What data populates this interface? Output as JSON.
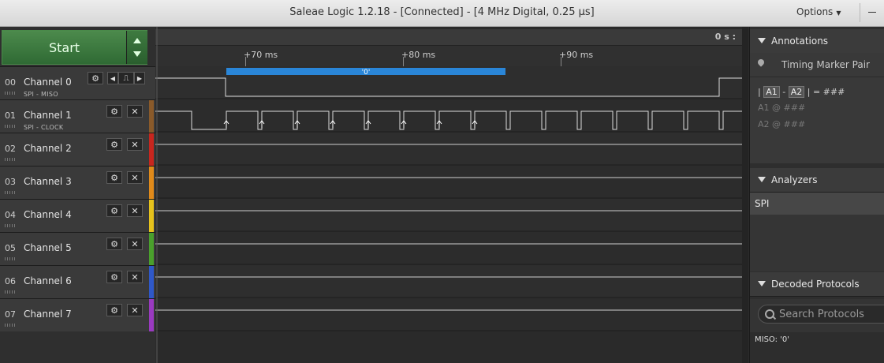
{
  "window": {
    "title": "Saleae Logic 1.2.18 - [Connected] - [4 MHz Digital, 0.25 µs]",
    "options_label": "Options"
  },
  "capture": {
    "start_label": "Start"
  },
  "timeline": {
    "zero_label": "0 s :",
    "ticks": [
      "+70 ms",
      "+80 ms",
      "+90 ms"
    ]
  },
  "channels": [
    {
      "num": "00",
      "name": "Channel 0",
      "sub": "SPI - MISO",
      "color": "#3a3a3a"
    },
    {
      "num": "01",
      "name": "Channel 1",
      "sub": "SPI - CLOCK",
      "color": "#8a5a2a"
    },
    {
      "num": "02",
      "name": "Channel 2",
      "sub": "",
      "color": "#c8261e"
    },
    {
      "num": "03",
      "name": "Channel 3",
      "sub": "",
      "color": "#e08a1a"
    },
    {
      "num": "04",
      "name": "Channel 4",
      "sub": "",
      "color": "#e6c21c"
    },
    {
      "num": "05",
      "name": "Channel 5",
      "sub": "",
      "color": "#4aa02c"
    },
    {
      "num": "06",
      "name": "Channel 6",
      "sub": "",
      "color": "#2f58c8"
    },
    {
      "num": "07",
      "name": "Channel 7",
      "sub": "",
      "color": "#9a3ac0"
    }
  ],
  "decode_bubble": {
    "text": "'0'",
    "color": "#2a86d8"
  },
  "annotations": {
    "header": "Annotations",
    "marker_pair": "Timing Marker Pair",
    "formula": {
      "bar": "|",
      "a1": "A1",
      "dash": "-",
      "a2": "A2",
      "eq": "| = ###"
    },
    "a1_line": "A1  @  ###",
    "a2_line": "A2  @  ###"
  },
  "analyzers": {
    "header": "Analyzers",
    "items": [
      "SPI"
    ]
  },
  "decoded": {
    "header": "Decoded Protocols",
    "search_placeholder": "Search Protocols",
    "results": [
      "MISO: '0'"
    ]
  }
}
